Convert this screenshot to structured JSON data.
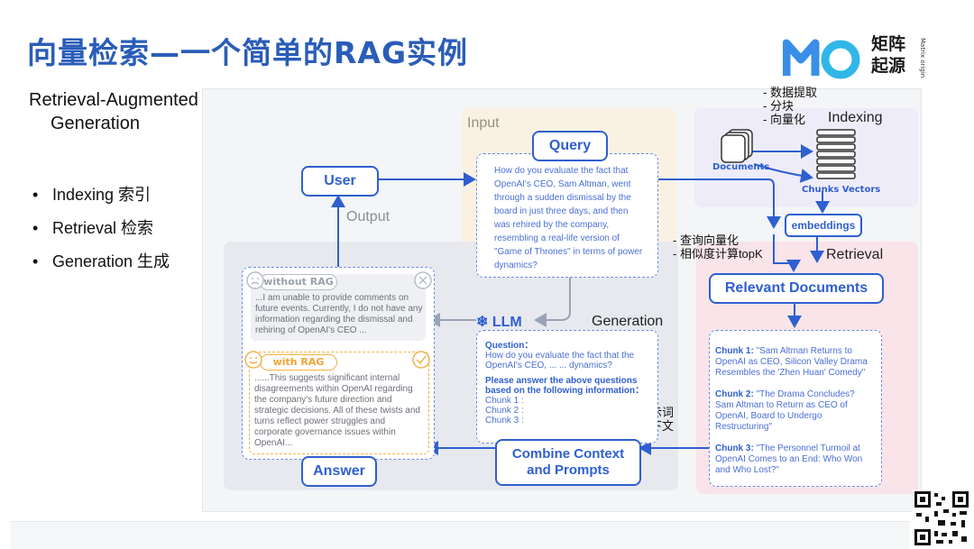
{
  "slide": {
    "title": "向量检索—一个简单的RAG实例"
  },
  "logo": {
    "line1": "矩阵",
    "line2": "起源",
    "tagline": "Matrix origin"
  },
  "intro": {
    "heading_line1": "Retrieval-Augmented",
    "heading_line2": "Generation",
    "bullets": [
      "Indexing 索引",
      "Retrieval 检索",
      "Generation 生成"
    ]
  },
  "diagram": {
    "regions": {
      "input": "Input",
      "indexing": "Indexing",
      "retrieval": "Retrieval",
      "generation": "Generation",
      "output": "Output"
    },
    "user_label": "User",
    "query_label": "Query",
    "query_text": "How do you evaluate the fact that OpenAI's CEO, Sam Altman, went through a sudden dismissal by the board in just three days, and then was rehired by the company, resembling a real-life version of \"Game of Thrones\" in terms of power dynamics?",
    "indexing": {
      "documents_label": "Documents",
      "chunks_vectors_label": "Chunks Vectors",
      "embeddings_label": "embeddings",
      "notes": "- 数据提取\n- 分块\n- 向量化"
    },
    "retrieval": {
      "relevant_docs_label": "Relevant Documents",
      "notes": "- 查询向量化\n- 相似度计算topK",
      "chunks": [
        {
          "label": "Chunk 1:",
          "text": "\"Sam Altman Returns to OpenAI as CEO, Silicon Valley Drama Resembles the 'Zhen Huan' Comedy\""
        },
        {
          "label": "Chunk 2:",
          "text": "\"The Drama Concludes? Sam Altman to Return as CEO of OpenAI, Board to Undergo Restructuring\""
        },
        {
          "label": "Chunk 3:",
          "text": "\"The Personnel Turmoil at OpenAI Comes to an End: Who Won and Who Lost?\""
        }
      ]
    },
    "generation": {
      "llm_label": "LLM",
      "question_label": "Question：",
      "question_text": "How do you evaluate the fact that the OpenAI's CEO, ... ... dynamics?",
      "instruction": "Please answer the above questions based on the following information：",
      "chunk_slots": [
        "Chunk 1 :",
        "Chunk 2 :",
        "Chunk 3 :"
      ],
      "combine_label_1": "Combine Context",
      "combine_label_2": "and Prompts",
      "notes": "- 提示词\n- 上下文"
    },
    "answers": {
      "answer_label": "Answer",
      "without_rag_label": "without RAG",
      "without_rag_text": "...I am unable to provide comments on future events. Currently, I do not have any information regarding the dismissal and rehiring of OpenAI's CEO ...",
      "with_rag_label": "with RAG",
      "with_rag_text": "......This suggests significant internal disagreements within OpenAI regarding the company's future direction and strategic decisions. All of these twists and turns reflect power struggles and corporate governance issues within OpenAI..."
    }
  },
  "colors": {
    "title_blue": "#2a5db8",
    "accent_blue": "#2f5fd0",
    "input_bg": "#faf1e3",
    "indexing_bg": "#eeecf8",
    "retrieval_bg": "#f9e4e9",
    "generation_bg": "#e7e9ef",
    "with_rag_orange": "#f2b24a"
  }
}
